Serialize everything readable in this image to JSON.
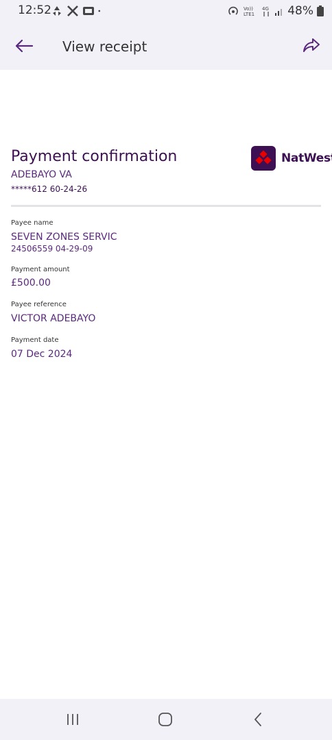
{
  "status_bar": {
    "time": "12:52",
    "battery": "48%",
    "icons_left": [
      "recycle-icon",
      "x-logo-icon",
      "gallery-icon",
      "dot-icon"
    ],
    "icons_right": [
      "hotspot-icon",
      "volte-icon",
      "4g-icon",
      "signal-icon",
      "battery-icon"
    ]
  },
  "header": {
    "title": "View receipt",
    "back_icon": "arrow-left-icon",
    "share_icon": "share-arrow-icon"
  },
  "receipt": {
    "title": "Payment confirmation",
    "account_name": "ADEBAYO VA",
    "account_number": "*****612 60-24-26",
    "logo_text": "NatWest",
    "fields": {
      "payee_name_label": "Payee name",
      "payee_name": "SEVEN ZONES SERVIC",
      "payee_account": "24506559 04-29-09",
      "amount_label": "Payment amount",
      "amount": "£500.00",
      "reference_label": "Payee reference",
      "reference": "VICTOR ADEBAYO",
      "date_label": "Payment date",
      "date": "07 Dec 2024"
    }
  },
  "colors": {
    "brand_purple": "#5a287d",
    "dark_purple": "#3c1053",
    "natwest_red": "#e90000",
    "header_bg": "#f2f1f7"
  }
}
